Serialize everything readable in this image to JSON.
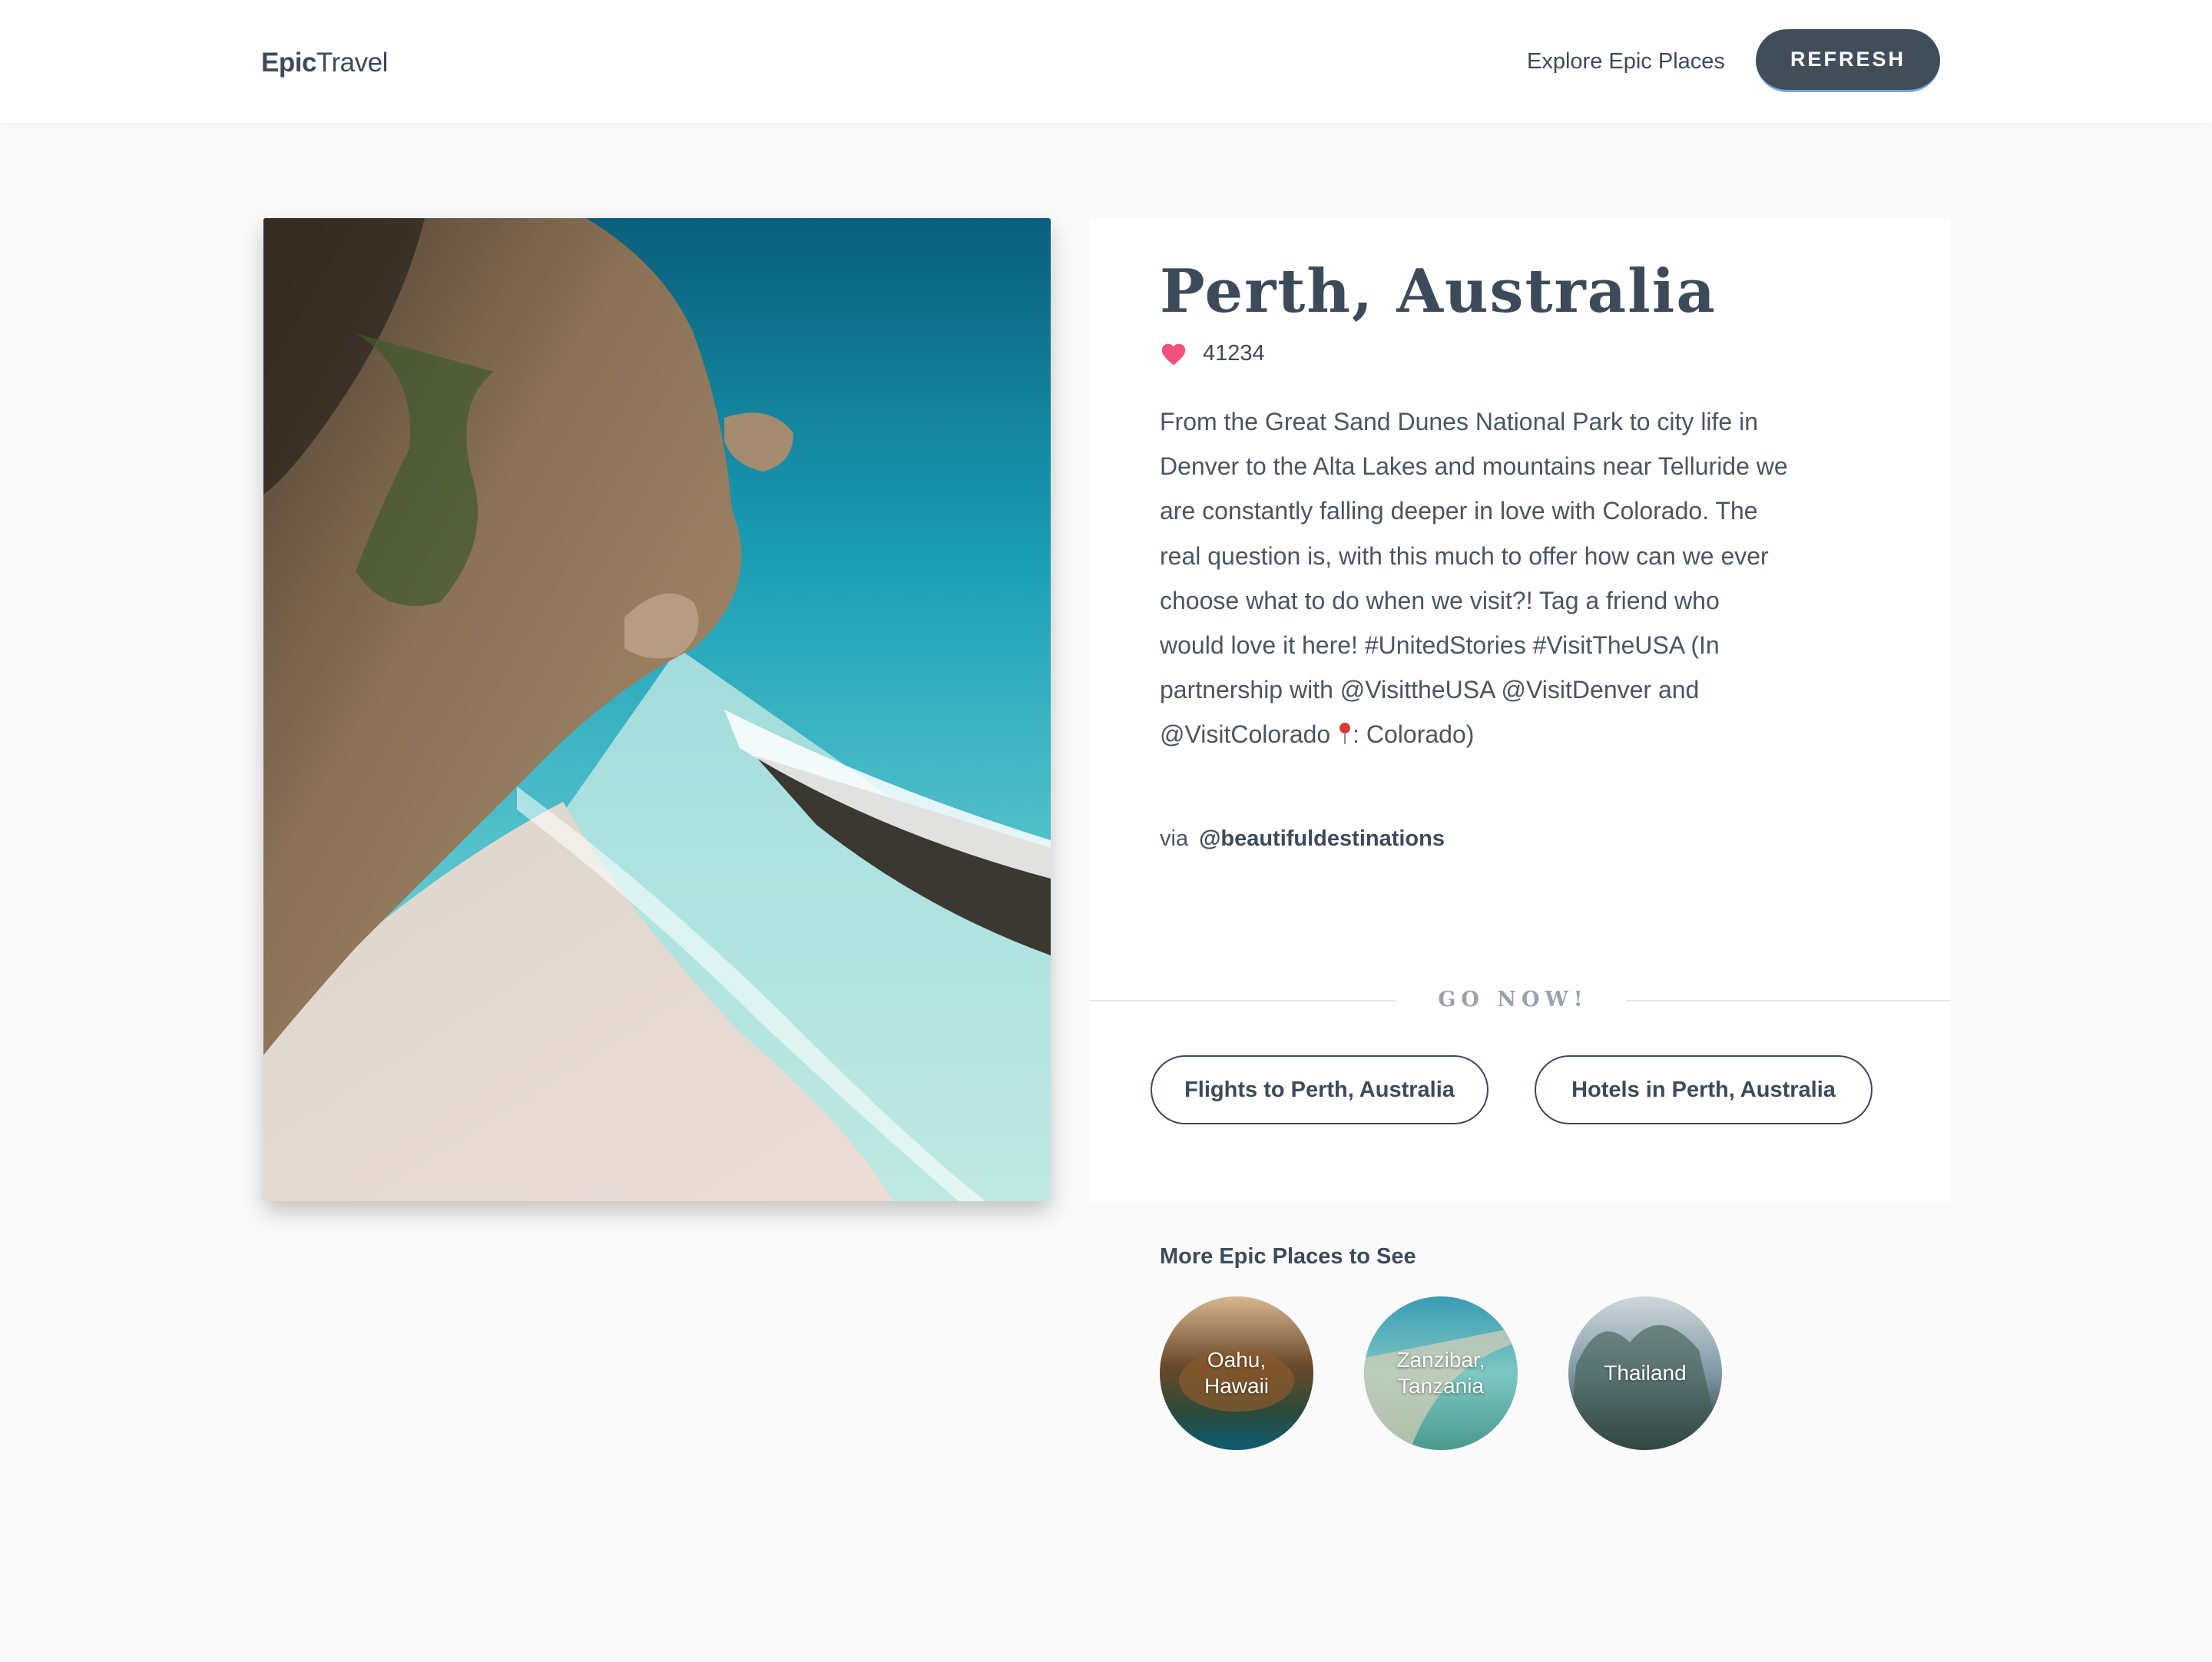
{
  "header": {
    "logo_bold": "Epic",
    "logo_light": "Travel",
    "nav_link": "Explore Epic Places",
    "refresh_label": "REFRESH"
  },
  "destination": {
    "title": "Perth, Australia",
    "likes": "41234",
    "description_main": "From the Great Sand Dunes National Park to city life in Denver to the Alta Lakes and mountains near Telluride we are constantly falling deeper in love with Colorado. The real question is, with this much to offer how can we ever choose what to do when we visit?! Tag a friend who would love it here! #UnitedStories #VisitTheUSA (In partnership with @VisittheUSA @VisitDenver and @VisitColorado",
    "description_tail": ": Colorado)",
    "via_label": "via",
    "via_handle": "@beautifuldestinations"
  },
  "go_now": {
    "label": "GO NOW!",
    "flights_button": "Flights to Perth, Australia",
    "hotels_button": "Hotels in Perth, Australia"
  },
  "more_places": {
    "title": "More Epic Places to See",
    "items": [
      {
        "name": "Oahu, Hawaii"
      },
      {
        "name": "Zanzibar, Tanzania"
      },
      {
        "name": "Thailand"
      }
    ]
  },
  "colors": {
    "primary_text": "#3d4a5a",
    "refresh_button": "#424d5a",
    "heart": "#f0507a",
    "page_bg": "#fafafa"
  },
  "icons": [
    "heart-icon",
    "pin-icon"
  ]
}
